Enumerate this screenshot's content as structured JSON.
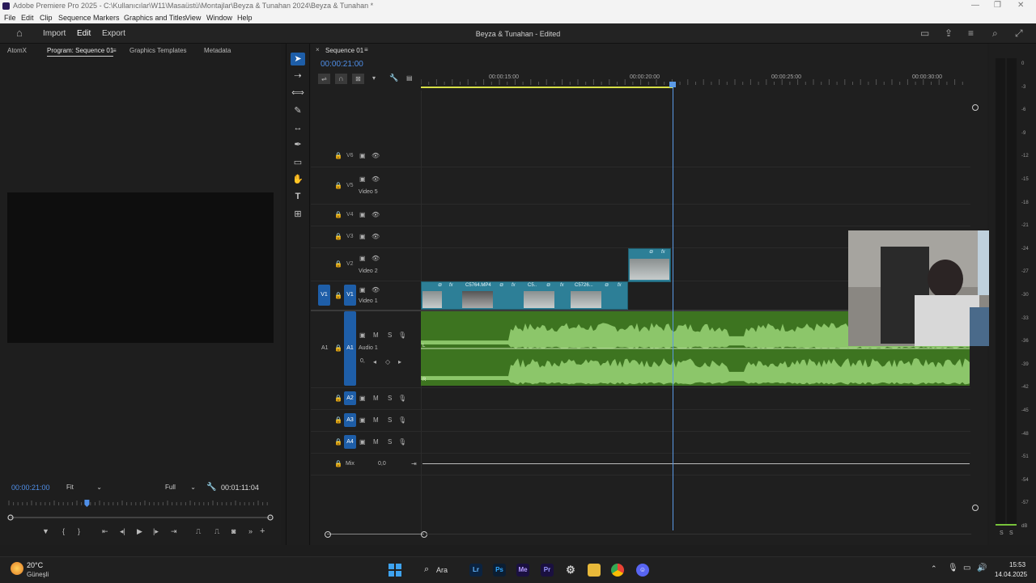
{
  "window": {
    "title": "Adobe Premiere Pro 2025 - C:\\Kullanıcılar\\W11\\Masaüstü\\Montajlar\\Beyza & Tunahan 2024\\Beyza & Tunahan *"
  },
  "menu": [
    "File",
    "Edit",
    "Clip",
    "Sequence",
    "Markers",
    "Graphics and Titles",
    "View",
    "Window",
    "Help"
  ],
  "header": {
    "nav": [
      "Import",
      "Edit",
      "Export"
    ],
    "active_nav": "Edit",
    "project_title": "Beyza & Tunahan - Edited"
  },
  "left_panel": {
    "tabs": [
      "AtomX",
      "Program: Sequence 01",
      "Graphics Templates",
      "Metadata"
    ],
    "active_tab": "Program: Sequence 01",
    "timecode": "00:00:21:00",
    "fit_select": "Fit",
    "quality_select": "Full",
    "duration": "00:01:11:04",
    "playhead_fraction": 0.295
  },
  "timeline": {
    "sequence_tab": "Sequence 01",
    "timecode": "00:00:21:00",
    "ruler": [
      "00:00:15:00",
      "00:00:20:00",
      "00:00:25:00",
      "00:00:30:00"
    ],
    "video_tracks": [
      {
        "id": "V6",
        "name": ""
      },
      {
        "id": "V5",
        "name": "Video 5"
      },
      {
        "id": "V4",
        "name": ""
      },
      {
        "id": "V3",
        "name": ""
      },
      {
        "id": "V2",
        "name": "Video 2"
      },
      {
        "id": "V1",
        "name": "Video 1",
        "source": "V1"
      }
    ],
    "audio_tracks": [
      {
        "id": "A1",
        "name": "Audio 1",
        "source": "A1",
        "volume": "0,"
      },
      {
        "id": "A2",
        "name": ""
      },
      {
        "id": "A3",
        "name": ""
      },
      {
        "id": "A4",
        "name": ""
      }
    ],
    "mix": {
      "label": "Mix",
      "value": "0,0"
    },
    "clips_v1": [
      "C5764.MP4",
      "C5..",
      "C5726..."
    ],
    "fx_label": "fx",
    "mute": "M",
    "solo": "S",
    "channel_left": "L",
    "channel_right": "R"
  },
  "meters": {
    "scale": [
      "0",
      "-3",
      "-6",
      "-9",
      "-12",
      "-15",
      "-18",
      "-21",
      "-24",
      "-27",
      "-30",
      "-33",
      "-36",
      "-39",
      "-42",
      "-45",
      "-48",
      "-51",
      "-54",
      "-57",
      "dB"
    ],
    "bottom": [
      "S",
      "S"
    ]
  },
  "taskbar": {
    "weather_temp": "20°C",
    "weather_desc": "Güneşli",
    "search": "Ara",
    "apps": [
      "Lr",
      "Ps",
      "Me",
      "Pr"
    ],
    "time": "15:53",
    "date": "14.04.2025"
  }
}
